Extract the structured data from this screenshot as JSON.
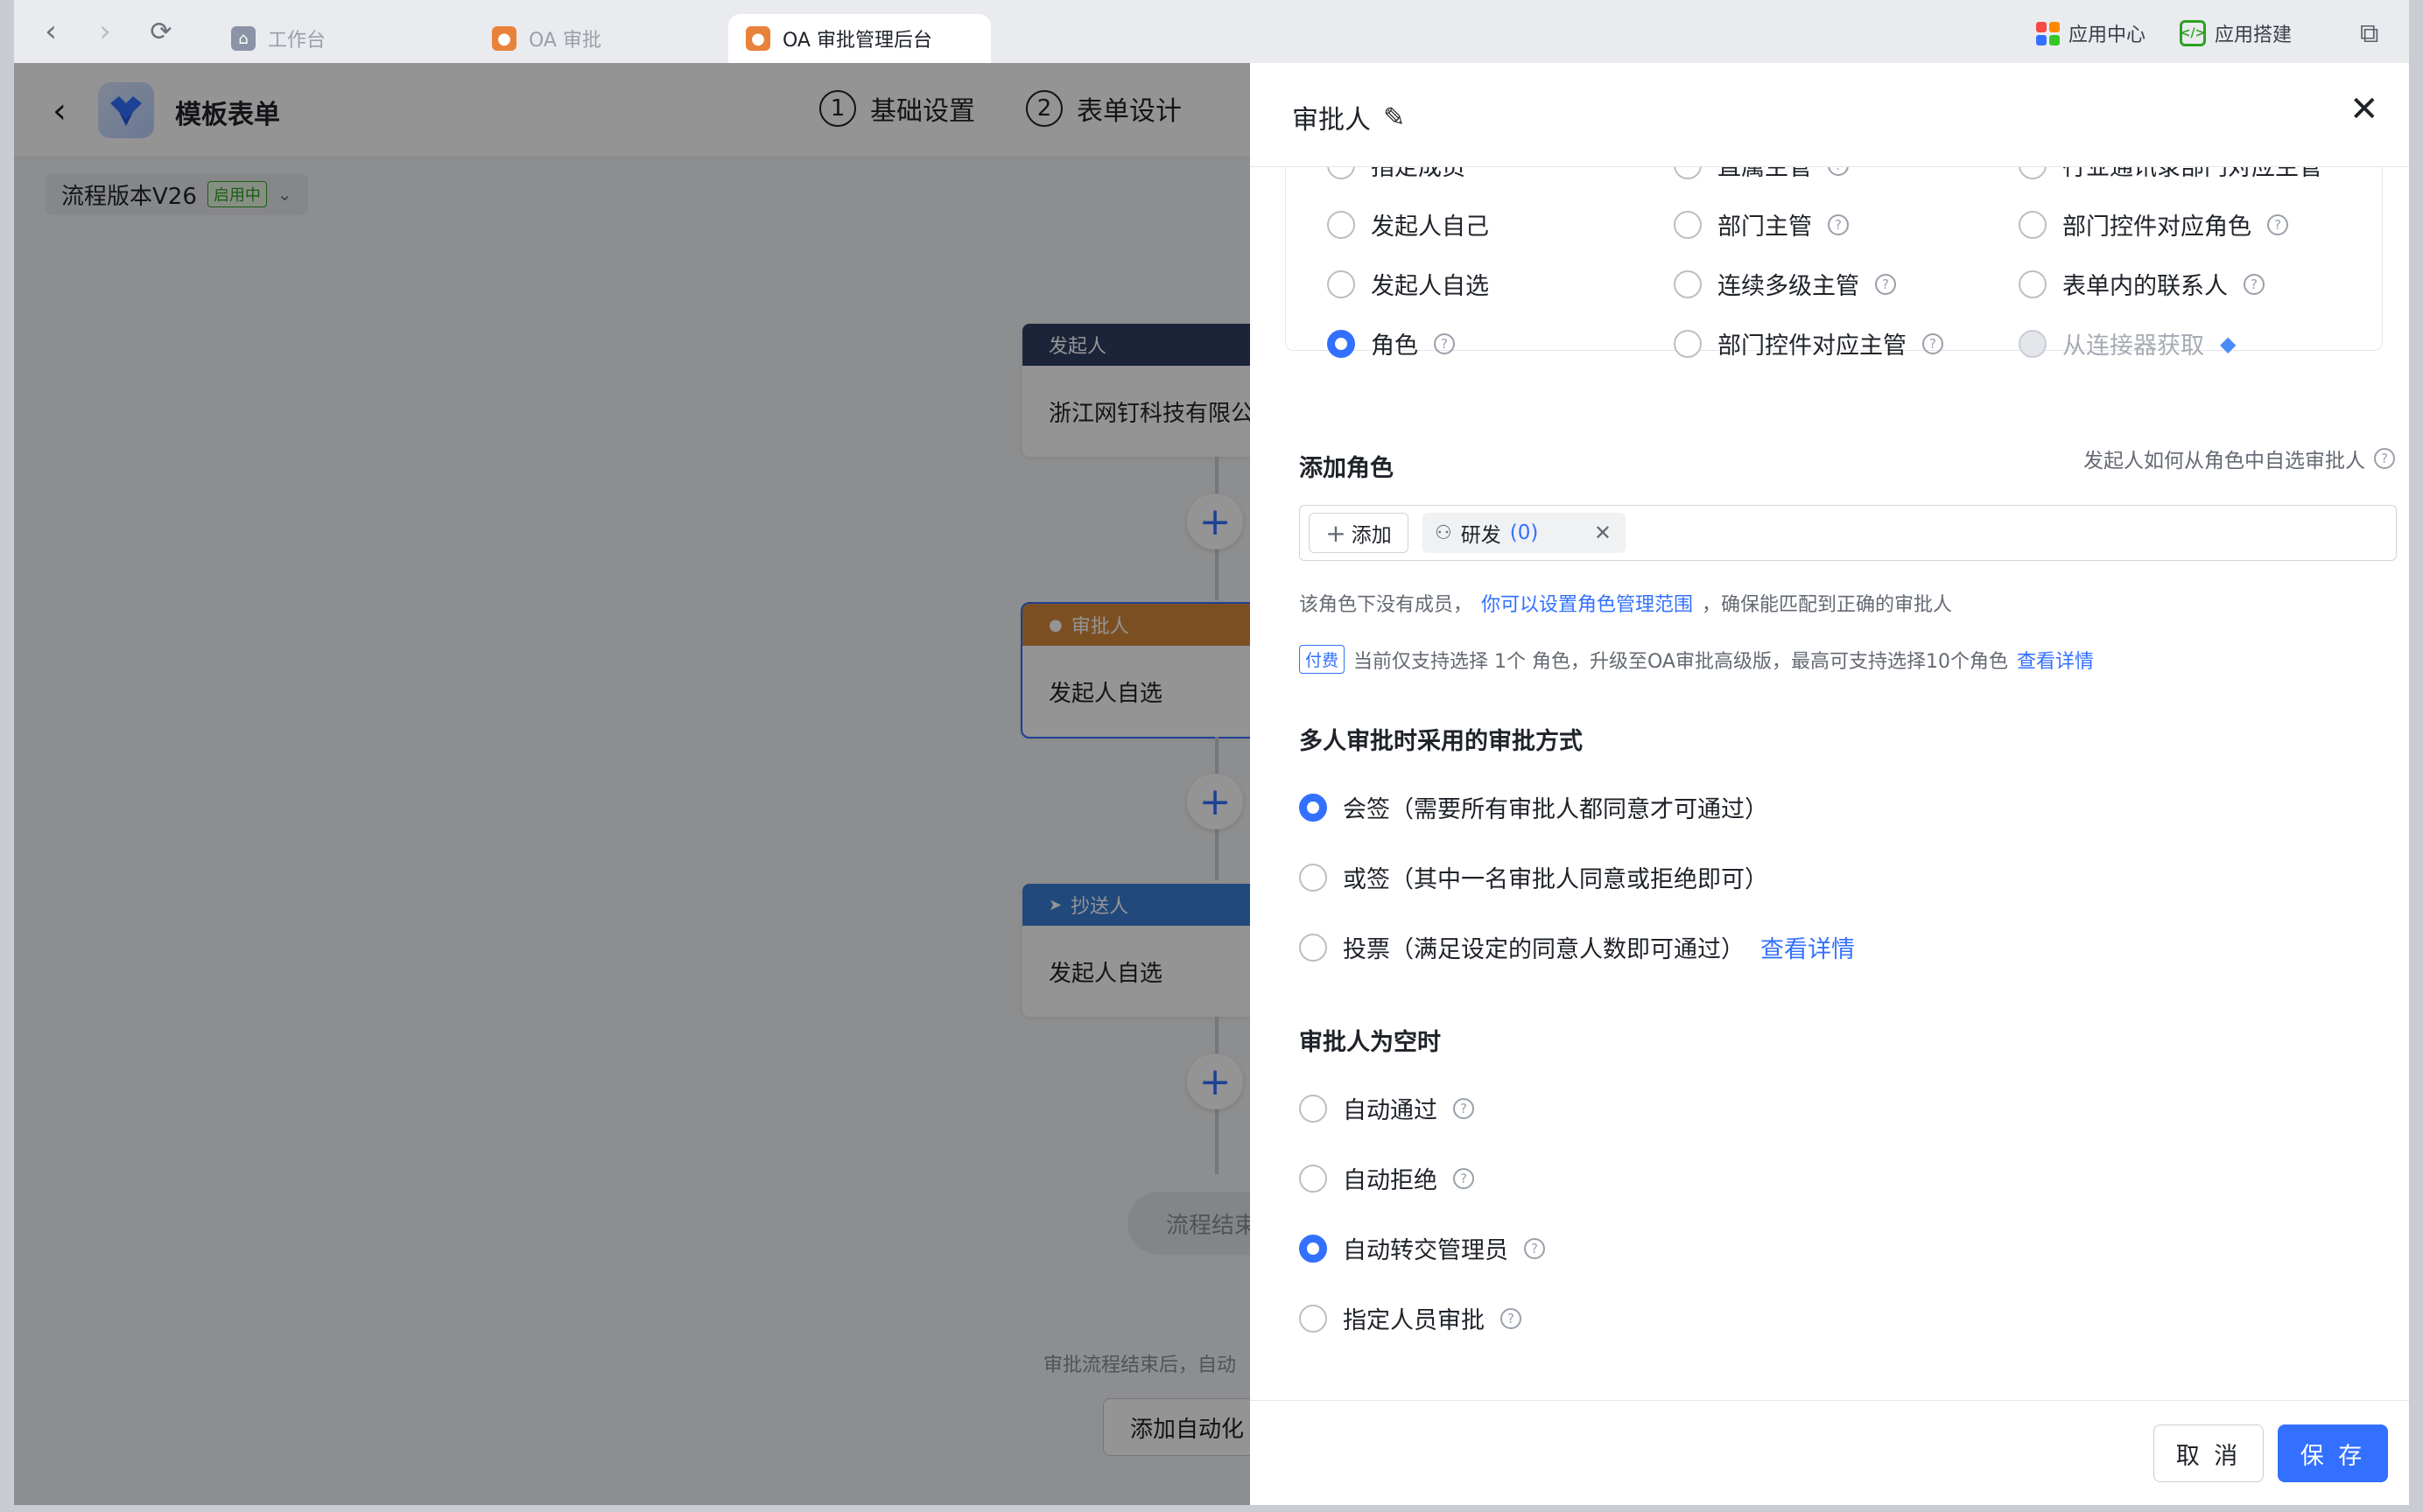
{
  "browser": {
    "tabs": [
      {
        "label": "工作台"
      },
      {
        "label": "OA 审批"
      },
      {
        "label": "OA 审批管理后台"
      }
    ],
    "right": {
      "app_center": "应用中心",
      "app_builder": "应用搭建"
    }
  },
  "header": {
    "title": "模板表单",
    "steps": [
      {
        "num": "1",
        "label": "基础设置"
      },
      {
        "num": "2",
        "label": "表单设计"
      }
    ]
  },
  "version": {
    "label": "流程版本V26",
    "status": "启用中"
  },
  "flow": {
    "nodes": [
      {
        "header": "发起人",
        "body": "浙江网钉科技有限公",
        "color": "#2f3f63"
      },
      {
        "header": "审批人",
        "body": "发起人自选",
        "color": "#d6893b"
      },
      {
        "header": "抄送人",
        "body": "发起人自选",
        "color": "#3a7fd5"
      }
    ],
    "end_label": "流程结束",
    "footer_note": "审批流程结束后，自动",
    "auto_button": "添加自动化"
  },
  "drawer": {
    "title": "审批人",
    "approver_types": [
      {
        "label": "指定成员",
        "help": false,
        "state": "off"
      },
      {
        "label": "直属主管",
        "help": true,
        "state": "off"
      },
      {
        "label": "行业通讯录部门对应主管",
        "help": false,
        "state": "off"
      },
      {
        "label": "发起人自己",
        "help": false,
        "state": "off"
      },
      {
        "label": "部门主管",
        "help": true,
        "state": "off"
      },
      {
        "label": "部门控件对应角色",
        "help": true,
        "state": "off"
      },
      {
        "label": "发起人自选",
        "help": false,
        "state": "off"
      },
      {
        "label": "连续多级主管",
        "help": true,
        "state": "off"
      },
      {
        "label": "表单内的联系人",
        "help": true,
        "state": "off"
      },
      {
        "label": "角色",
        "help": true,
        "state": "on"
      },
      {
        "label": "部门控件对应主管",
        "help": true,
        "state": "off"
      },
      {
        "label": "从连接器获取",
        "help": false,
        "state": "disabled"
      }
    ],
    "add_role": {
      "title": "添加角色",
      "hint": "发起人如何从角色中自选审批人",
      "add_label": "添加",
      "role_name": "研发",
      "role_count": "(0)",
      "note_prefix": "该角色下没有成员，",
      "note_link": "你可以设置角色管理范围",
      "note_suffix": "，确保能匹配到正确的审批人",
      "paid_badge": "付费",
      "paid_text": "当前仅支持选择 1个 角色，升级至OA审批高级版，最高可支持选择10个角色",
      "paid_link": "查看详情"
    },
    "multi_mode": {
      "title": "多人审批时采用的审批方式",
      "options": [
        {
          "label": "会签（需要所有审批人都同意才可通过）",
          "state": "on",
          "link": ""
        },
        {
          "label": "或签（其中一名审批人同意或拒绝即可）",
          "state": "off",
          "link": ""
        },
        {
          "label": "投票（满足设定的同意人数即可通过）",
          "state": "off",
          "link": "查看详情"
        }
      ]
    },
    "empty_mode": {
      "title": "审批人为空时",
      "options": [
        {
          "label": "自动通过",
          "state": "off"
        },
        {
          "label": "自动拒绝",
          "state": "off"
        },
        {
          "label": "自动转交管理员",
          "state": "on"
        },
        {
          "label": "指定人员审批",
          "state": "off"
        }
      ]
    },
    "buttons": {
      "cancel": "取 消",
      "save": "保 存"
    }
  }
}
